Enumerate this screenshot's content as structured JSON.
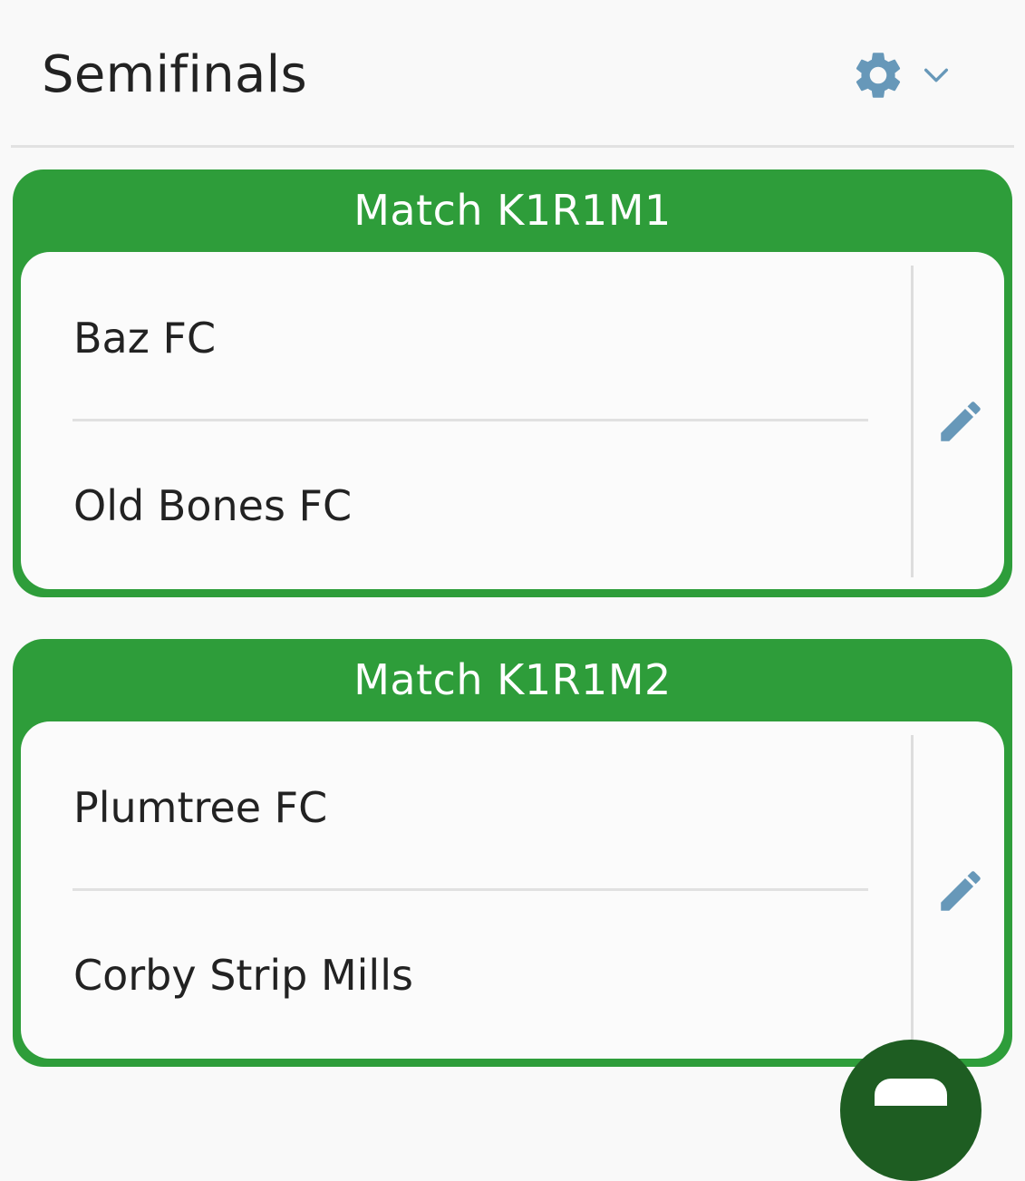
{
  "header": {
    "title": "Semifinals",
    "settings_icon": "gear-icon",
    "dropdown_icon": "chevron-down-icon",
    "icon_color": "#6798b9"
  },
  "matches": [
    {
      "title": "Match K1R1M1",
      "home_team": "Baz FC",
      "away_team": "Old Bones FC",
      "edit_icon": "pencil-icon"
    },
    {
      "title": "Match K1R1M2",
      "home_team": "Plumtree FC",
      "away_team": "Corby Strip Mills",
      "edit_icon": "pencil-icon"
    }
  ],
  "fab": {
    "icon": "chat-icon",
    "color": "#1e5d22"
  },
  "colors": {
    "accent": "#2e9d3a",
    "background": "#f9f9f9",
    "text": "#222222"
  }
}
